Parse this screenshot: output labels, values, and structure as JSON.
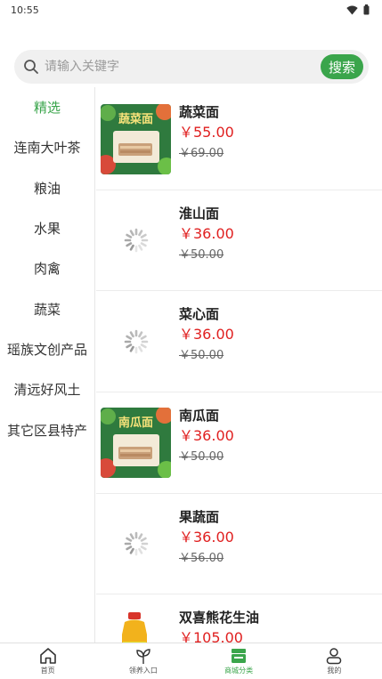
{
  "status_bar": {
    "time": "10:55"
  },
  "search": {
    "placeholder": "请输入关键字",
    "button_label": "搜索"
  },
  "categories": [
    "精选",
    "连南大叶茶",
    "粮油",
    "水果",
    "肉禽",
    "蔬菜",
    "瑶族文创产品",
    "清远好风土",
    "其它区县特产"
  ],
  "active_category": "精选",
  "products": [
    {
      "name": "蔬菜面",
      "price": "￥55.00",
      "original_price": "￥69.00",
      "image": "noodle-pack",
      "pack_title": "蔬菜面"
    },
    {
      "name": "淮山面",
      "price": "￥36.00",
      "original_price": "￥50.00",
      "image": "loading"
    },
    {
      "name": "菜心面",
      "price": "￥36.00",
      "original_price": "￥50.00",
      "image": "loading"
    },
    {
      "name": "南瓜面",
      "price": "￥36.00",
      "original_price": "￥50.00",
      "image": "noodle-pack",
      "pack_title": "南瓜面"
    },
    {
      "name": "果蔬面",
      "price": "￥36.00",
      "original_price": "￥56.00",
      "image": "loading"
    },
    {
      "name": "双喜熊花生油",
      "price": "￥105.00",
      "original_price": "",
      "image": "oil-bottle"
    }
  ],
  "tabbar": [
    {
      "label": "首页",
      "icon": "home-icon"
    },
    {
      "label": "领养入口",
      "icon": "sprout-icon"
    },
    {
      "label": "商城分类",
      "icon": "shop-category-icon"
    },
    {
      "label": "我的",
      "icon": "user-icon"
    }
  ],
  "colors": {
    "accent": "#3aa54b",
    "price": "#e02020"
  }
}
